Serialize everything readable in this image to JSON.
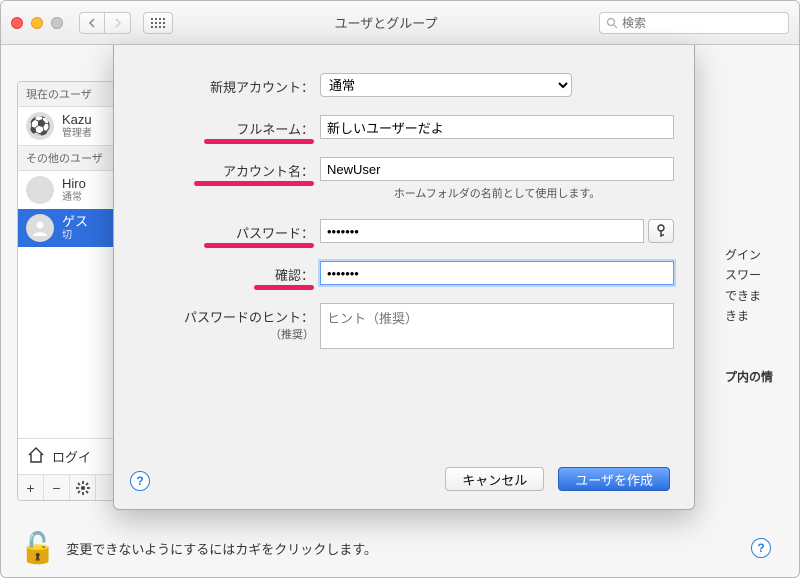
{
  "window": {
    "title": "ユーザとグループ",
    "search_placeholder": "検索"
  },
  "sidebar": {
    "section_current": "現在のユーザ",
    "section_other": "その他のユーザ",
    "users": [
      {
        "name": "Kazu",
        "sub": "管理者"
      },
      {
        "name": "Hiro",
        "sub": "通常"
      },
      {
        "name": "ゲス",
        "sub": "切"
      }
    ],
    "login_options": "ログイ"
  },
  "right_hint": {
    "l1": "グイン",
    "l2": "スワー",
    "l3": "できま",
    "l4": "きま",
    "l5": "プ内の情"
  },
  "sheet": {
    "account_type_label": "新規アカウント：",
    "account_type_value": "通常",
    "fullname_label": "フルネーム：",
    "fullname_value": "新しいユーザーだよ",
    "account_name_label": "アカウント名：",
    "account_name_value": "NewUser",
    "account_name_hint": "ホームフォルダの名前として使用します。",
    "password_label": "パスワード：",
    "password_value": "•••••••",
    "confirm_label": "確認：",
    "confirm_value": "•••••••",
    "hint_label_1": "パスワードのヒント：",
    "hint_label_2": "（推奨）",
    "hint_placeholder": "ヒント（推奨）",
    "cancel": "キャンセル",
    "create": "ユーザを作成"
  },
  "lock": {
    "text": "変更できないようにするにはカギをクリックします。"
  }
}
